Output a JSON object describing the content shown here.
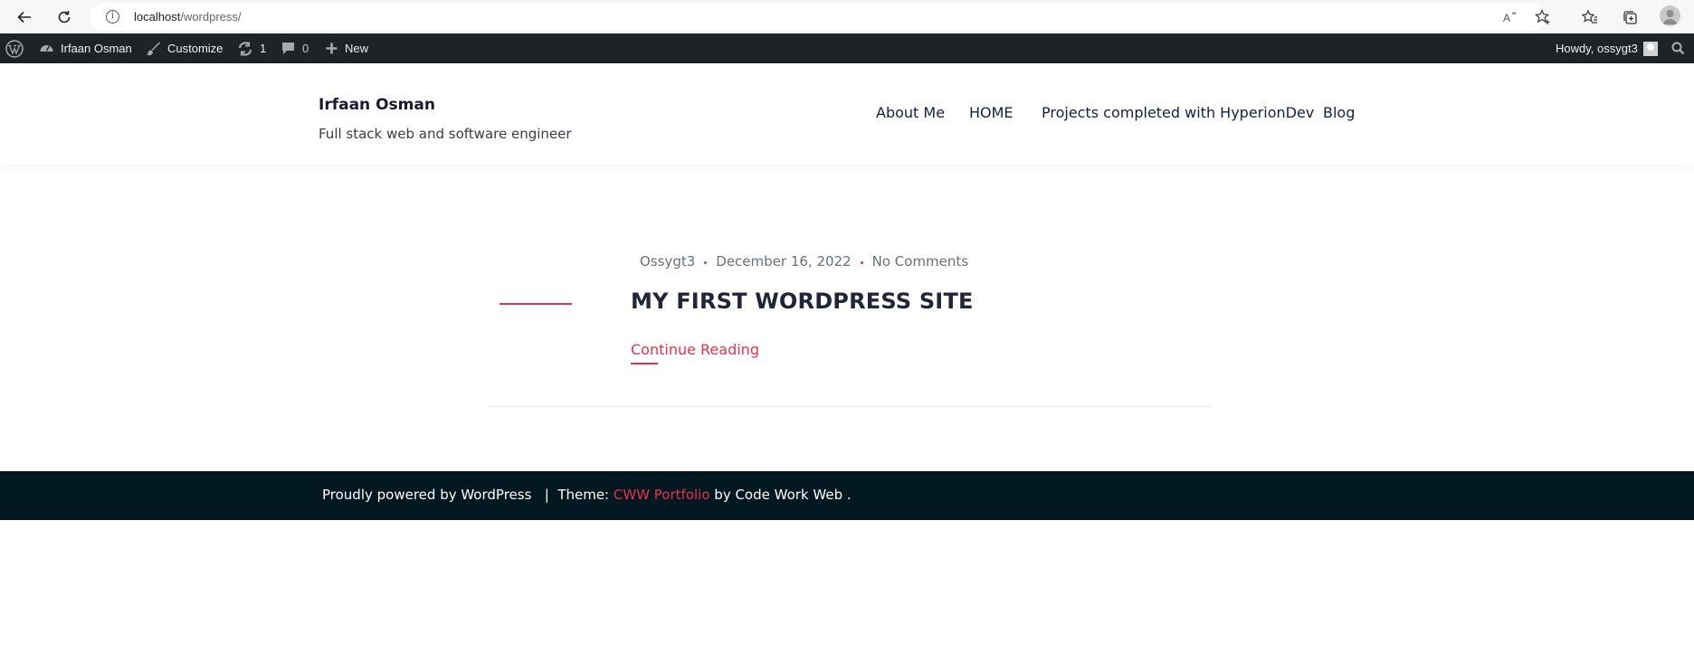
{
  "browser": {
    "url_host": "localhost",
    "url_path": "/wordpress/"
  },
  "admin_bar": {
    "site_name": "Irfaan Osman",
    "customize": "Customize",
    "updates_count": "1",
    "comments_count": "0",
    "new": "New",
    "howdy": "Howdy, ossygt3"
  },
  "header": {
    "site_title": "Irfaan Osman",
    "tagline": "Full stack web and software engineer",
    "nav": [
      "About Me",
      "HOME",
      "Projects completed with HyperionDev",
      "Blog"
    ]
  },
  "post": {
    "author": "Ossygt3",
    "date": "December 16, 2022",
    "comments": "No Comments",
    "title": "MY FIRST WORDPRESS SITE",
    "read_more": "Continue Reading"
  },
  "footer": {
    "powered": "Proudly powered by WordPress",
    "separator": "|",
    "theme_label": "Theme:",
    "theme_name": "CWW Portfolio",
    "by": "by Code Work Web ."
  },
  "colors": {
    "accent": "#e9314d",
    "admin_bar": "#1d2327",
    "footer": "#021820",
    "nav_text": "#141e4a"
  }
}
